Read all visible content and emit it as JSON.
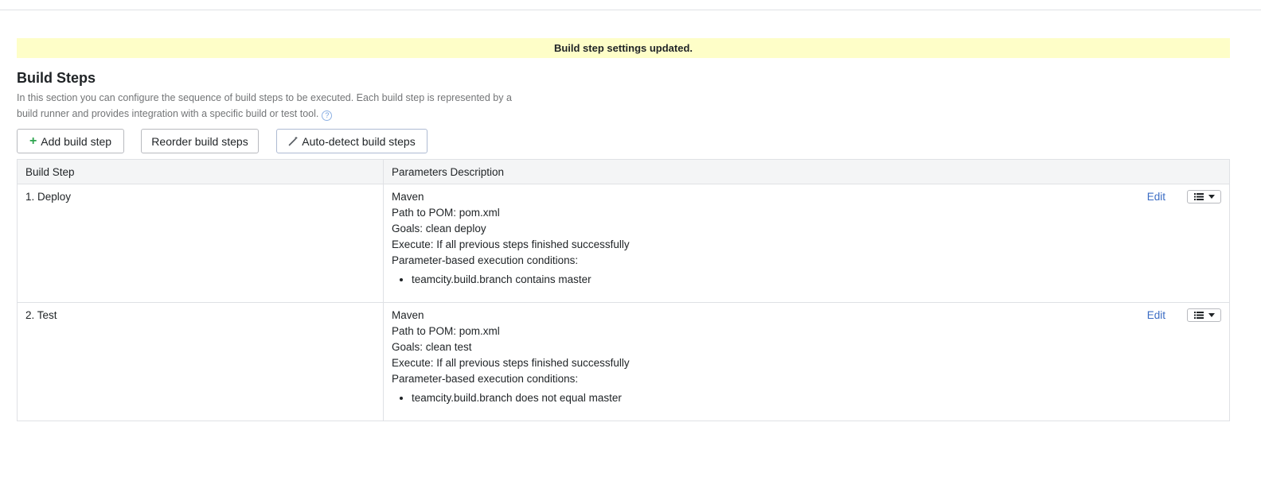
{
  "message": "Build step settings updated.",
  "section": {
    "title": "Build Steps",
    "description_line1": "In this section you can configure the sequence of build steps to be executed. Each build step is represented by a",
    "description_line2": "build runner and provides integration with a specific build or test tool.",
    "help_icon_glyph": "?"
  },
  "toolbar": {
    "add_label": "Add build step",
    "reorder_label": "Reorder build steps",
    "autodetect_label": "Auto-detect build steps"
  },
  "table": {
    "headers": [
      "Build Step",
      "Parameters Description"
    ],
    "rows": [
      {
        "step": "1. Deploy",
        "runner": "Maven",
        "pom": "Path to POM: pom.xml",
        "goals": "Goals: clean deploy",
        "execute": "Execute: If all previous steps finished successfully",
        "conditions_label": "Parameter-based execution conditions:",
        "condition": "teamcity.build.branch contains master",
        "edit": "Edit"
      },
      {
        "step": "2. Test",
        "runner": "Maven",
        "pom": "Path to POM: pom.xml",
        "goals": "Goals: clean test",
        "execute": "Execute: If all previous steps finished successfully",
        "conditions_label": "Parameter-based execution conditions:",
        "condition": "teamcity.build.branch does not equal master",
        "edit": "Edit"
      }
    ]
  },
  "colors": {
    "message_bg": "#fefec8",
    "link": "#3b6cc4",
    "plus": "#2da44e"
  }
}
